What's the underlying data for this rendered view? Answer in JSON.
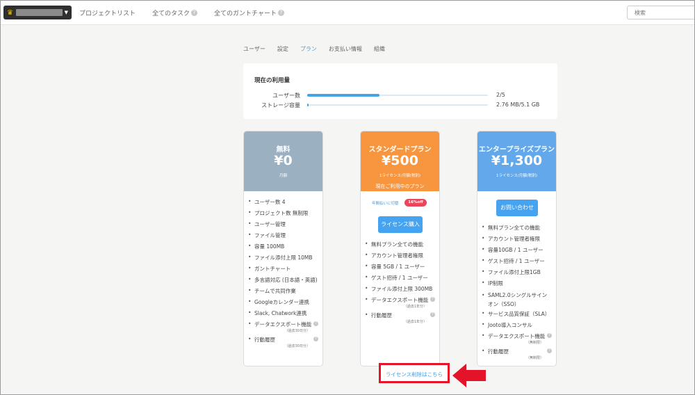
{
  "topbar": {
    "nav": [
      {
        "label": "プロジェクトリスト",
        "help": false
      },
      {
        "label": "全てのタスク",
        "help": true
      },
      {
        "label": "全てのガントチャート",
        "help": true
      }
    ],
    "search_placeholder": "検索"
  },
  "tabs": [
    {
      "label": "ユーザー",
      "active": false
    },
    {
      "label": "設定",
      "active": false
    },
    {
      "label": "プラン",
      "active": true
    },
    {
      "label": "お支払い情報",
      "active": false
    },
    {
      "label": "組織",
      "active": false
    }
  ],
  "usage": {
    "title": "現在の利用量",
    "users": {
      "label": "ユーザー数",
      "value": "2/5",
      "fraction": 0.4
    },
    "storage": {
      "label": "ストレージ容量",
      "value": "2.76 MB/5.1 GB",
      "fraction": 0.0005
    }
  },
  "plans": {
    "free": {
      "name": "無料",
      "price": "¥0",
      "sub": "月額",
      "color": "#9bb0c1",
      "features": [
        "ユーザー数 4",
        "プロジェクト数 無制限",
        "ユーザー管理",
        "ファイル管理",
        "容量 100MB",
        "ファイル添付上限 10MB",
        "ガントチャート",
        "多言語対応 (日本語・英語)",
        "チームで共同作業",
        "Googleカレンダー連携",
        "Slack, Chatwork連携"
      ],
      "help_features": [
        {
          "label": "データエクスポート機能",
          "note": "（過去30日分）"
        },
        {
          "label": "行動履歴",
          "note": "（過去30日分）"
        }
      ]
    },
    "standard": {
      "name": "スタンダードプラン",
      "price": "¥500",
      "sub": "1ライセンス/月額(税別)",
      "current": "現在ご利用中のプラン",
      "color": "#f7963f",
      "annual_link": "年間払いに切替",
      "badge": "16%off",
      "buy_button": "ライセンス購入",
      "features": [
        "無料プラン全ての機能",
        "アカウント管理者権限",
        "容量 5GB / 1 ユーザー",
        "ゲスト招待 / 1 ユーザー",
        "ファイル添付上限 300MB"
      ],
      "help_features": [
        {
          "label": "データエクスポート機能",
          "note": "（過去1年分）"
        },
        {
          "label": "行動履歴",
          "note": "（過去1年分）"
        }
      ]
    },
    "enterprise": {
      "name": "エンタープライズプラン",
      "price": "¥1,300",
      "sub": "1ライセンス/月額(税別)",
      "color": "#62a8ea",
      "contact_button": "お問い合わせ",
      "features": [
        "無料プラン全ての機能",
        "アカウント管理者権限",
        "容量10GB / 1 ユーザー",
        "ゲスト招待 / 1 ユーザー",
        "ファイル添付上限1GB",
        "IP制限"
      ],
      "wrap_feature": "SAML2.0シングルサインオン（SSO）",
      "features2": [
        "サービス品質保証（SLA）",
        "Jooto導入コンサル"
      ],
      "help_features": [
        {
          "label": "データエクスポート機能",
          "note": "（無制限）"
        },
        {
          "label": "行動履歴",
          "note": "（無制限）"
        }
      ]
    }
  },
  "cancel_link": "ライセンス削除はこちら",
  "accent": "#45a3ef",
  "highlight": "#e3142a"
}
